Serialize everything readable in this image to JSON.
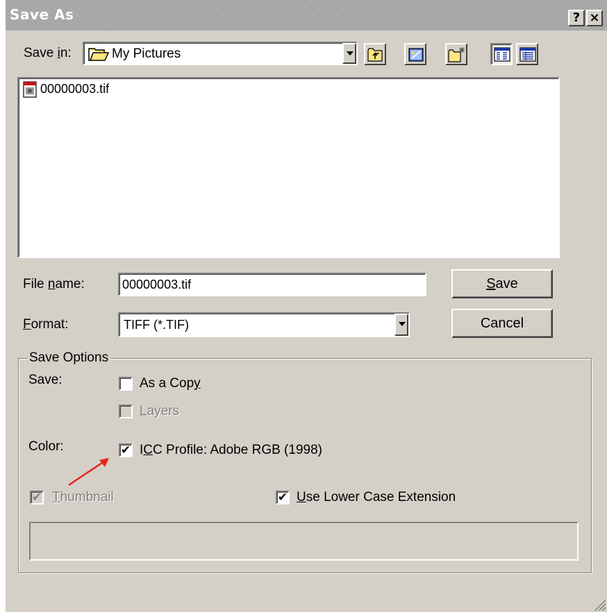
{
  "window": {
    "title": "Save As",
    "help_btn": "?",
    "close_btn": "×"
  },
  "save_in": {
    "label_pre": "Save ",
    "label_key": "i",
    "label_post": "n:",
    "value": "My Pictures"
  },
  "toolbar": {
    "icons": [
      "up-one-level-icon",
      "desktop-icon",
      "new-folder-icon",
      "list-view-icon",
      "details-view-icon"
    ]
  },
  "files": [
    {
      "name": "00000003.tif",
      "icon": "tif-file-icon"
    }
  ],
  "filename": {
    "label_pre": "File ",
    "label_key": "n",
    "label_post": "ame:",
    "value": "00000003.tif"
  },
  "format": {
    "label_key": "F",
    "label_post": "ormat:",
    "value": "TIFF (*.TIF)"
  },
  "buttons": {
    "save_key": "S",
    "save_post": "ave",
    "cancel": "Cancel"
  },
  "options": {
    "group_label": "Save Options",
    "save_label": "Save:",
    "as_copy_pre": "As a Cop",
    "as_copy_key": "y",
    "as_copy_checked": false,
    "layers_key": "L",
    "layers_post": "ayers",
    "layers_checked": false,
    "color_label": "Color:",
    "icc_pre": "I",
    "icc_key": "C",
    "icc_post": "C Profile:  Adobe RGB (1998)",
    "icc_checked": true,
    "thumbnail_key": "T",
    "thumbnail_post": "humbnail",
    "thumbnail_checked": true,
    "lower_key": "U",
    "lower_post": "se Lower Case Extension",
    "lower_checked": true
  },
  "annotation": {
    "arrow_color": "#e8231a"
  }
}
